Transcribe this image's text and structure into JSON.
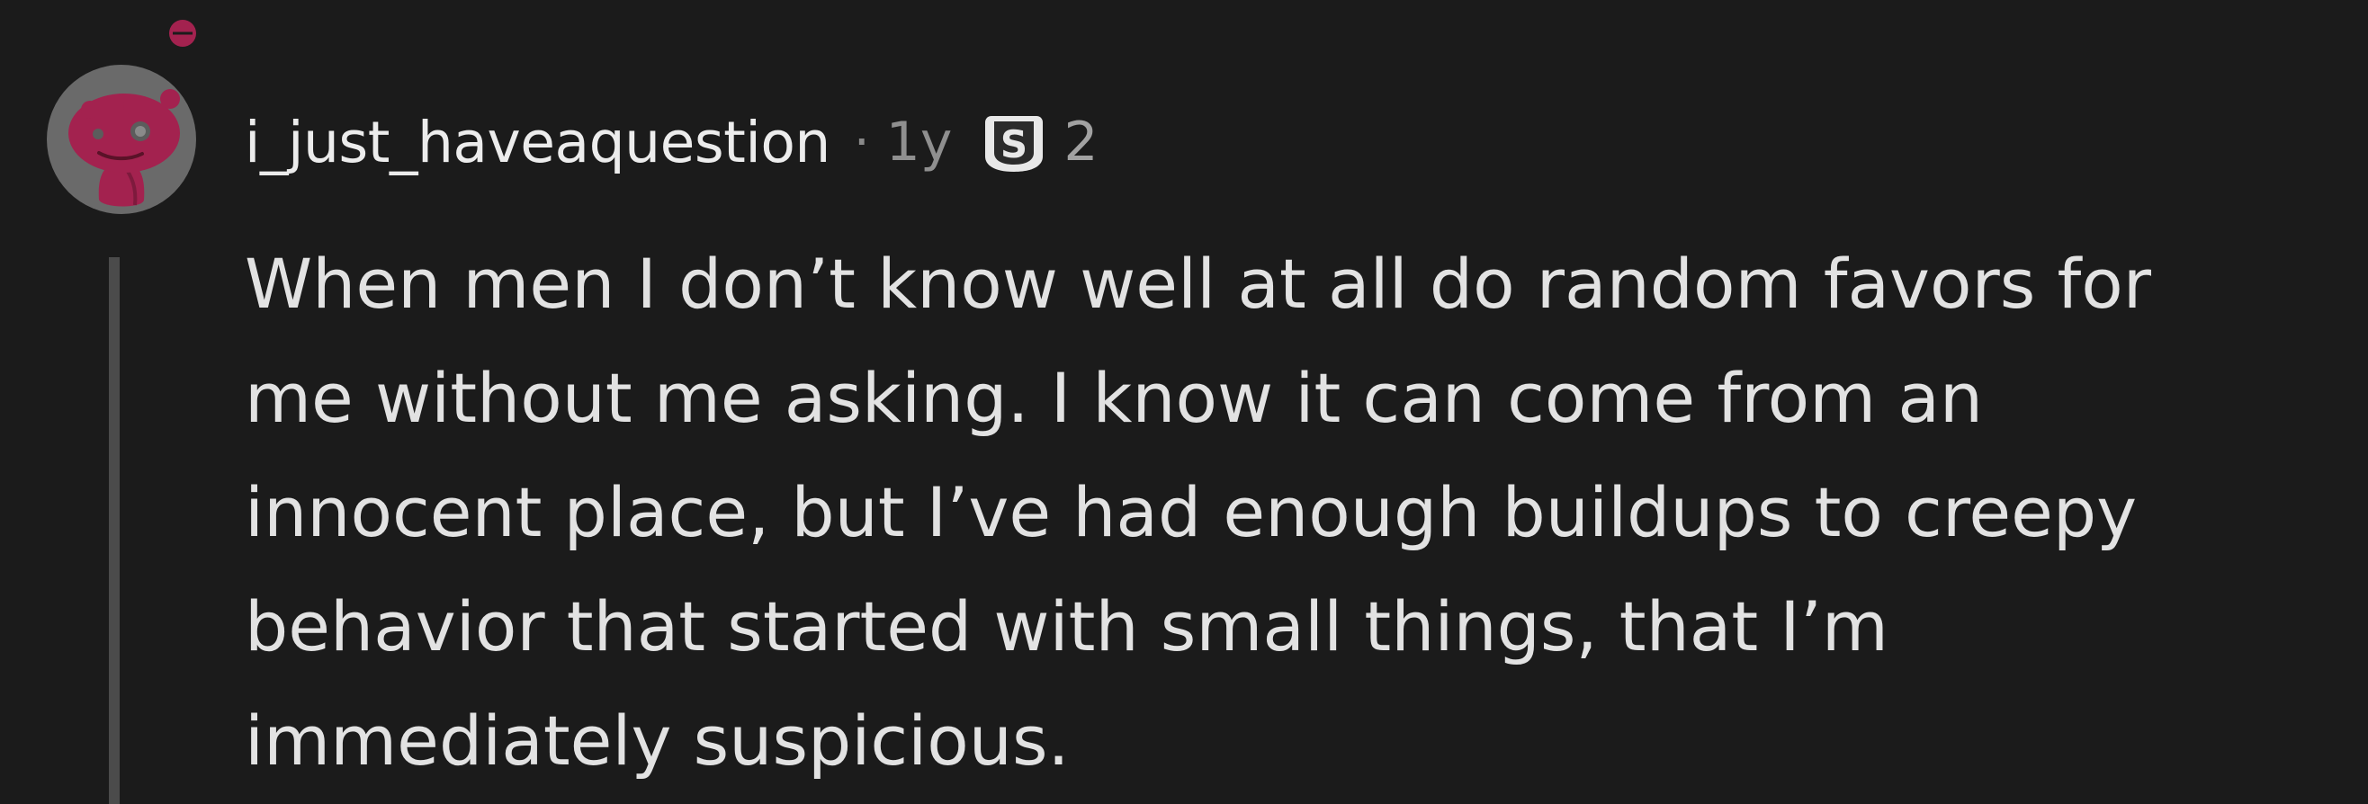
{
  "comment": {
    "author": "i_just_haveaquestion",
    "separator": "·",
    "age": "1y",
    "award": {
      "icon": "silver-award-icon",
      "count": "2"
    },
    "body_lines": [
      "When men I don’t know well at all do random favors for",
      "me without me asking. I know it can come from an",
      "innocent place, but I’ve had enough buildups to creepy",
      "behavior that started with small things, that I’m",
      "immediately suspicious."
    ]
  },
  "colors": {
    "background": "#1b1b1b",
    "avatar_accent": "#a3224f",
    "avatar_bg": "#6a6a6a",
    "thread_line": "#4b4b4b",
    "meta_text": "#8f8f8f",
    "body_text": "#e2e2e2"
  }
}
